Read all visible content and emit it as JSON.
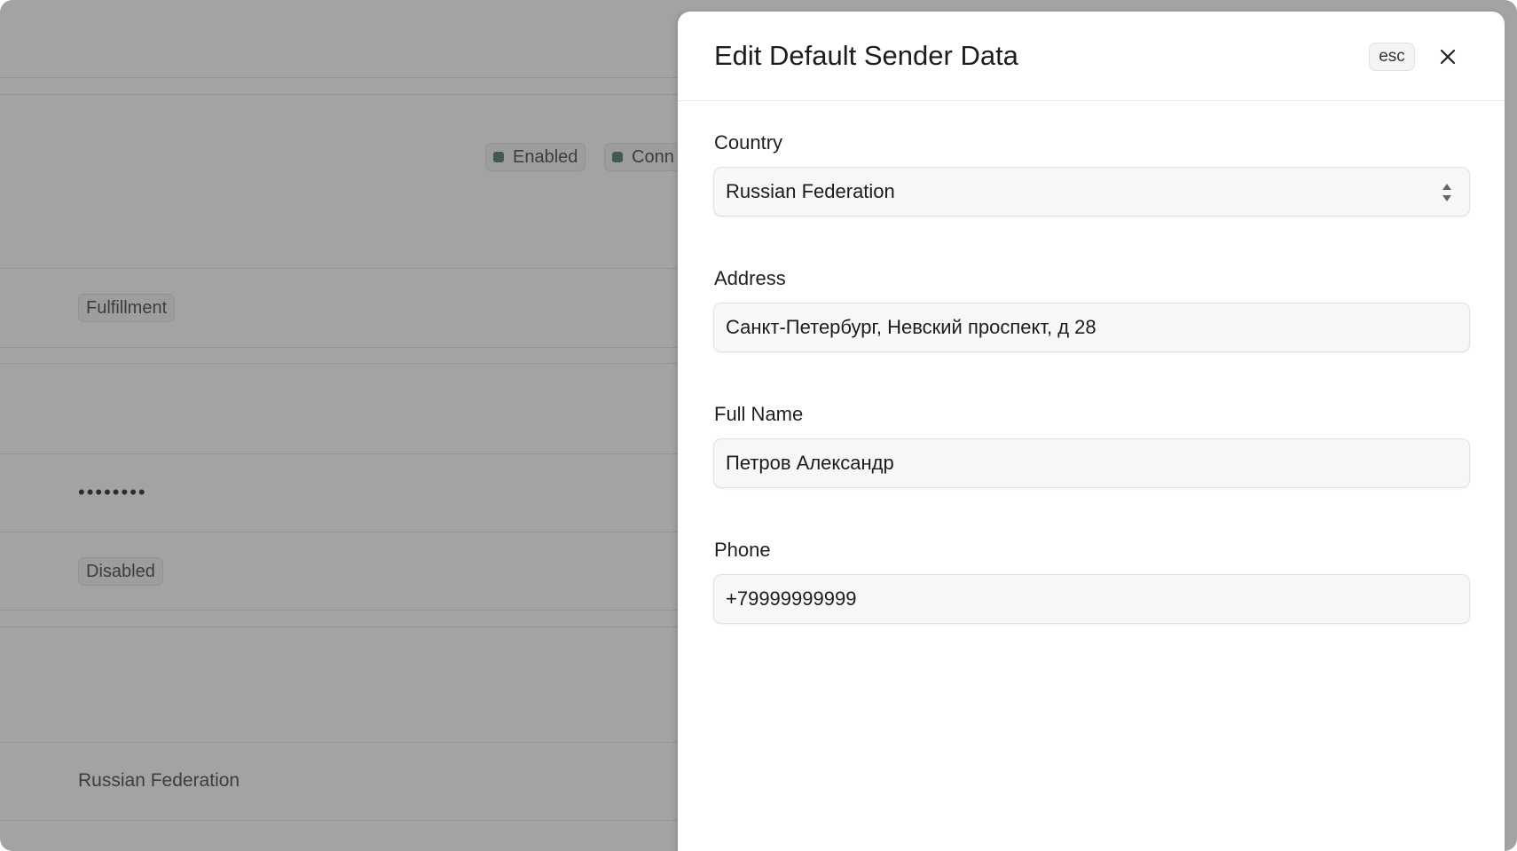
{
  "background": {
    "badges": {
      "enabled": "Enabled",
      "connected_partial": "Conn",
      "fulfillment": "Fulfillment",
      "disabled": "Disabled"
    },
    "password_mask": "••••••••",
    "country_value": "Russian Federation"
  },
  "modal": {
    "title": "Edit Default Sender Data",
    "esc_label": "esc",
    "fields": {
      "country": {
        "label": "Country",
        "value": "Russian Federation"
      },
      "address": {
        "label": "Address",
        "value": "Санкт-Петербург, Невский проспект, д 28"
      },
      "full_name": {
        "label": "Full Name",
        "value": "Петров Александр"
      },
      "phone": {
        "label": "Phone",
        "value": "+79999999999"
      }
    }
  },
  "colors": {
    "overlay": "#a3a3a3",
    "status_dot": "#425a50",
    "panel_bg": "#ffffff",
    "field_bg": "#f7f7f7"
  },
  "icons": {
    "close": "close-icon",
    "select": "select-arrows-icon"
  }
}
